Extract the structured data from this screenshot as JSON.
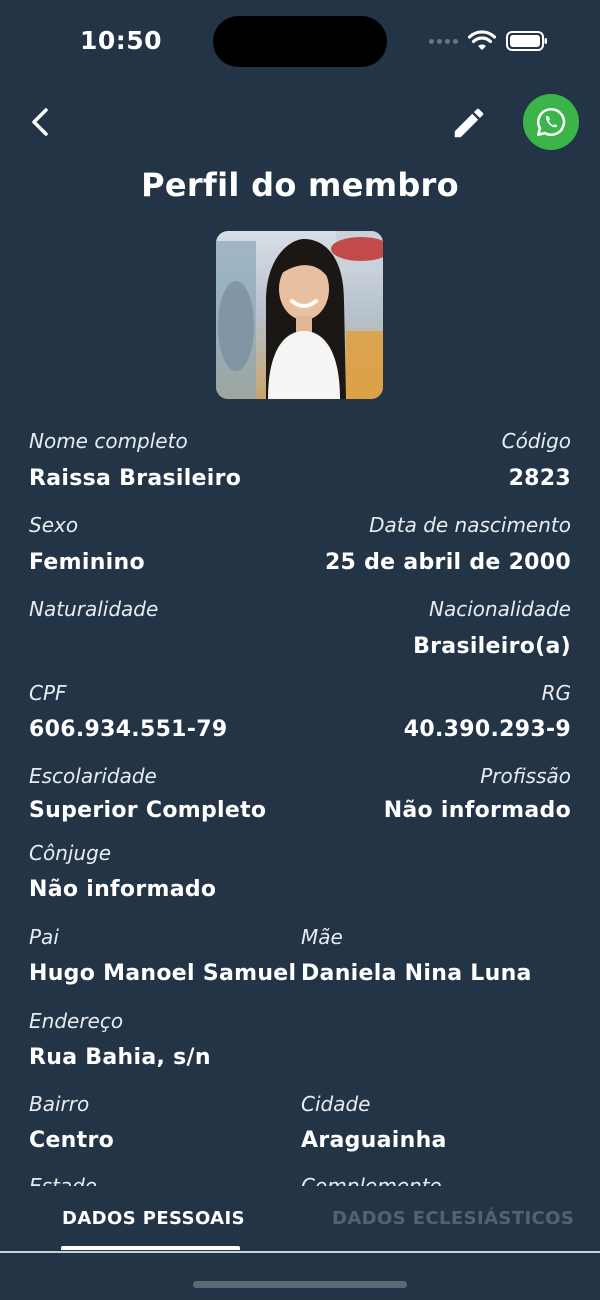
{
  "status_bar": {
    "time": "10:50"
  },
  "header": {
    "title": "Perfil do membro"
  },
  "colors": {
    "background": "#243447",
    "whatsapp": "#3bb54a",
    "tab_inactive": "#536273"
  },
  "icons": {
    "back": "chevron-left-icon",
    "edit": "pencil-icon",
    "whatsapp": "whatsapp-icon"
  },
  "fields": {
    "nome_completo": {
      "label": "Nome completo",
      "value": "Raissa Brasileiro"
    },
    "codigo": {
      "label": "Código",
      "value": "2823"
    },
    "sexo": {
      "label": "Sexo",
      "value": "Feminino"
    },
    "data_nascimento": {
      "label": "Data de nascimento",
      "value": "25 de abril de 2000"
    },
    "naturalidade": {
      "label": "Naturalidade",
      "value": ""
    },
    "nacionalidade": {
      "label": "Nacionalidade",
      "value": "Brasileiro(a)"
    },
    "cpf": {
      "label": "CPF",
      "value": "606.934.551-79"
    },
    "rg": {
      "label": "RG",
      "value": "40.390.293-9"
    },
    "escolaridade": {
      "label": "Escolaridade",
      "value": "Superior Completo"
    },
    "profissao": {
      "label": "Profissão",
      "value": "Não informado"
    },
    "conjuge": {
      "label": "Cônjuge",
      "value": "Não informado"
    },
    "pai": {
      "label": "Pai",
      "value": "Hugo Manoel Samuel"
    },
    "mae": {
      "label": "Mãe",
      "value": "Daniela Nina Luna"
    },
    "endereco": {
      "label": "Endereço",
      "value": "Rua Bahia, s/n"
    },
    "bairro": {
      "label": "Bairro",
      "value": "Centro"
    },
    "cidade": {
      "label": "Cidade",
      "value": "Araguainha"
    },
    "estado": {
      "label": "Estado"
    },
    "complemento": {
      "label": "Complemento"
    }
  },
  "tabs": [
    {
      "label": "DADOS PESSOAIS",
      "active": true
    },
    {
      "label": "DADOS ECLESIÁSTICOS",
      "active": false
    }
  ]
}
